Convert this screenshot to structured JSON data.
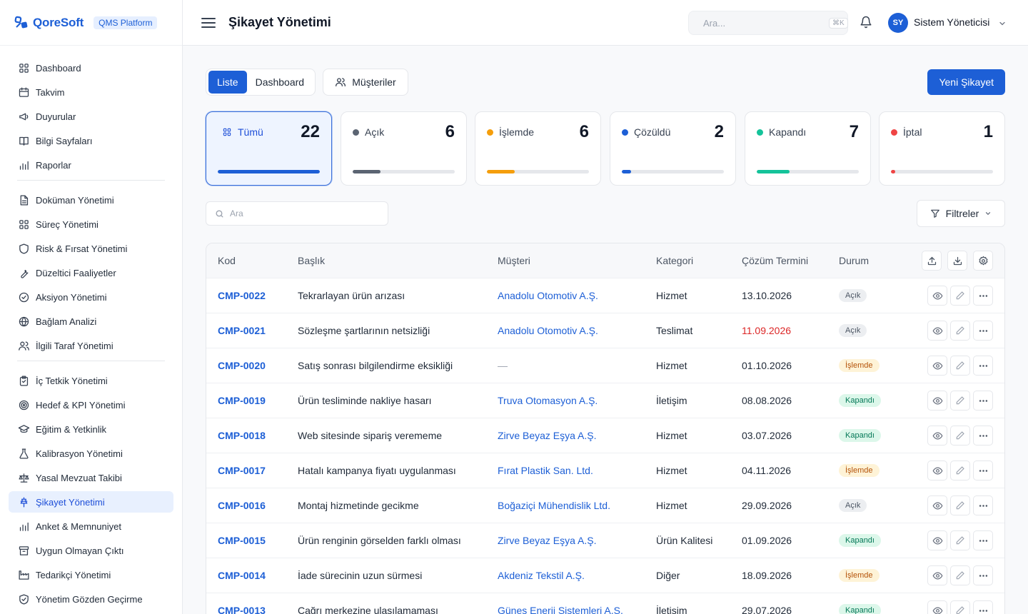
{
  "brand": {
    "name": "QoreSoft",
    "platform_badge": "QMS Platform"
  },
  "sidebar": {
    "groups": [
      [
        {
          "label": "Dashboard",
          "icon": "grid-icon"
        },
        {
          "label": "Takvim",
          "icon": "calendar-icon"
        },
        {
          "label": "Duyurular",
          "icon": "megaphone-icon"
        },
        {
          "label": "Bilgi Sayfaları",
          "icon": "book-icon"
        },
        {
          "label": "Raporlar",
          "icon": "bar-chart-icon"
        }
      ],
      [
        {
          "label": "Doküman Yönetimi",
          "icon": "document-icon"
        },
        {
          "label": "Süreç Yönetimi",
          "icon": "grid-icon"
        },
        {
          "label": "Risk & Fırsat Yönetimi",
          "icon": "shield-icon"
        },
        {
          "label": "Düzeltici Faaliyetler",
          "icon": "wrench-icon"
        },
        {
          "label": "Aksiyon Yönetimi",
          "icon": "check-circle-icon"
        },
        {
          "label": "Bağlam Analizi",
          "icon": "globe-icon"
        },
        {
          "label": "İlgili Taraf Yönetimi",
          "icon": "users-icon"
        }
      ],
      [
        {
          "label": "İç Tetkik Yönetimi",
          "icon": "clipboard-icon"
        },
        {
          "label": "Hedef & KPI Yönetimi",
          "icon": "target-icon"
        },
        {
          "label": "Eğitim & Yetkinlik",
          "icon": "graduation-cap-icon"
        },
        {
          "label": "Kalibrasyon Yönetimi",
          "icon": "flask-icon"
        },
        {
          "label": "Yasal Mevzuat Takibi",
          "icon": "scale-icon"
        },
        {
          "label": "Şikayet Yönetimi",
          "icon": "pin-icon",
          "active": true
        },
        {
          "label": "Anket & Memnuniyet",
          "icon": "bar-chart-icon"
        },
        {
          "label": "Uygun Olmayan Çıktı",
          "icon": "archive-icon"
        },
        {
          "label": "Tedarikçi Yönetimi",
          "icon": "factory-icon"
        },
        {
          "label": "Yönetim Gözden Geçirme",
          "icon": "shield-check-icon"
        }
      ]
    ]
  },
  "header": {
    "title": "Şikayet Yönetimi",
    "search_placeholder": "Ara...",
    "search_shortcut": "⌘K",
    "user_initials": "SY",
    "user_name": "Sistem Yöneticisi"
  },
  "toolbar": {
    "view_options": [
      "Liste",
      "Dashboard"
    ],
    "selected_view": "Liste",
    "customers_label": "Müşteriler",
    "new_label": "Yeni Şikayet"
  },
  "status_cards": [
    {
      "label": "Tümü",
      "count": 22,
      "fraction": 1.0,
      "color": "#1d5fd6",
      "selected": true
    },
    {
      "label": "Açık",
      "count": 6,
      "fraction": 0.27,
      "color": "#5b6472"
    },
    {
      "label": "İşlemde",
      "count": 6,
      "fraction": 0.27,
      "color": "#f59e0b"
    },
    {
      "label": "Çözüldü",
      "count": 2,
      "fraction": 0.09,
      "color": "#1d5fd6"
    },
    {
      "label": "Kapandı",
      "count": 7,
      "fraction": 0.32,
      "color": "#14c39a"
    },
    {
      "label": "İptal",
      "count": 1,
      "fraction": 0.045,
      "color": "#ef4444"
    }
  ],
  "list": {
    "search_placeholder": "Ara",
    "filter_label": "Filtreler",
    "columns": [
      "Kod",
      "Başlık",
      "Müşteri",
      "Kategori",
      "Çözüm Termini",
      "Durum"
    ],
    "rows": [
      {
        "code": "CMP-0022",
        "title": "Tekrarlayan ürün arızası",
        "customer": "Anadolu Otomotiv A.Ş.",
        "category": "Hizmet",
        "due": "13.10.2026",
        "overdue": false,
        "status": "Açık"
      },
      {
        "code": "CMP-0021",
        "title": "Sözleşme şartlarının netsizliği",
        "customer": "Anadolu Otomotiv A.Ş.",
        "category": "Teslimat",
        "due": "11.09.2026",
        "overdue": true,
        "status": "Açık"
      },
      {
        "code": "CMP-0020",
        "title": "Satış sonrası bilgilendirme eksikliği",
        "customer": "—",
        "category": "Hizmet",
        "due": "01.10.2026",
        "overdue": false,
        "status": "İşlemde"
      },
      {
        "code": "CMP-0019",
        "title": "Ürün tesliminde nakliye hasarı",
        "customer": "Truva Otomasyon A.Ş.",
        "category": "İletişim",
        "due": "08.08.2026",
        "overdue": false,
        "status": "Kapandı"
      },
      {
        "code": "CMP-0018",
        "title": "Web sitesinde sipariş verememe",
        "customer": "Zirve Beyaz Eşya A.Ş.",
        "category": "Hizmet",
        "due": "03.07.2026",
        "overdue": false,
        "status": "Kapandı"
      },
      {
        "code": "CMP-0017",
        "title": "Hatalı kampanya fiyatı uygulanması",
        "customer": "Fırat Plastik San. Ltd.",
        "category": "Hizmet",
        "due": "04.11.2026",
        "overdue": false,
        "status": "İşlemde"
      },
      {
        "code": "CMP-0016",
        "title": "Montaj hizmetinde gecikme",
        "customer": "Boğaziçi Mühendislik Ltd.",
        "category": "Hizmet",
        "due": "29.09.2026",
        "overdue": false,
        "status": "Açık"
      },
      {
        "code": "CMP-0015",
        "title": "Ürün renginin görselden farklı olması",
        "customer": "Zirve Beyaz Eşya A.Ş.",
        "category": "Ürün Kalitesi",
        "due": "01.09.2026",
        "overdue": false,
        "status": "Kapandı"
      },
      {
        "code": "CMP-0014",
        "title": "İade sürecinin uzun sürmesi",
        "customer": "Akdeniz Tekstil A.Ş.",
        "category": "Diğer",
        "due": "18.09.2026",
        "overdue": false,
        "status": "İşlemde"
      },
      {
        "code": "CMP-0013",
        "title": "Çağrı merkezine ulaşılamaması",
        "customer": "Güneş Enerji Sistemleri A.Ş.",
        "category": "İletişim",
        "due": "29.07.2026",
        "overdue": false,
        "status": "Kapandı"
      }
    ]
  },
  "status_styles": {
    "Açık": {
      "bg": "#eceef1",
      "fg": "#4b5563"
    },
    "İşlemde": {
      "bg": "#fef3d7",
      "fg": "#b45309"
    },
    "Kapandı": {
      "bg": "#dcf7ea",
      "fg": "#047857"
    }
  }
}
